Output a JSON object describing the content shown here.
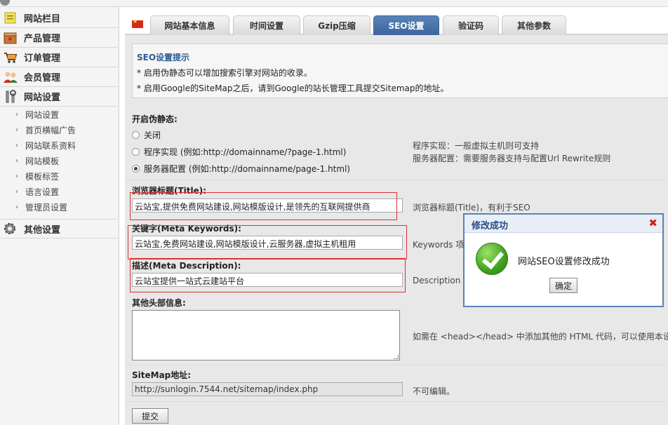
{
  "sidebar": {
    "sections": [
      {
        "label": "网站栏目",
        "icon": "note-icon"
      },
      {
        "label": "产品管理",
        "icon": "box-icon"
      },
      {
        "label": "订单管理",
        "icon": "cart-icon"
      },
      {
        "label": "会员管理",
        "icon": "users-icon"
      },
      {
        "label": "网站设置",
        "icon": "tools-icon"
      }
    ],
    "sub_items": [
      "网站设置",
      "首页横幅广告",
      "网站联系资料",
      "网站模板",
      "模板标签",
      "语言设置",
      "管理员设置"
    ],
    "bottom_section": {
      "label": "其他设置",
      "icon": "gear-icon"
    }
  },
  "tabs": [
    {
      "label": "网站基本信息",
      "active": false
    },
    {
      "label": "时间设置",
      "active": false
    },
    {
      "label": "Gzip压缩",
      "active": false
    },
    {
      "label": "SEO设置",
      "active": true
    },
    {
      "label": "验证码",
      "active": false
    },
    {
      "label": "其他参数",
      "active": false
    }
  ],
  "tip": {
    "title": "SEO设置提示",
    "lines": [
      "* 启用伪静态可以增加搜索引擎对网站的收录。",
      "* 启用Google的SiteMap之后，请到Google的站长管理工具提交Sitemap的地址。"
    ]
  },
  "rewrite": {
    "label": "开启伪静态:",
    "options": [
      {
        "label": "关闭",
        "selected": false
      },
      {
        "label": "程序实现 (例如:http://domainname/?page-1.html)",
        "selected": false
      },
      {
        "label": "服务器配置 (例如:http://domainname/page-1.html)",
        "selected": true
      }
    ],
    "notes": [
      "程序实现：一般虚拟主机则可支持",
      "服务器配置：需要服务器支持与配置Url Rewrite规则"
    ]
  },
  "title_field": {
    "label": "浏览器标题(Title):",
    "value": "云站宝,提供免费网站建设,网站模版设计,是领先的互联网提供商",
    "note": "浏览器标题(Title)，有利于SEO"
  },
  "keywords_field": {
    "label": "关键字(Meta Keywords):",
    "value": "云站宝,免费网站建设,网站模版设计,云服务器,虚拟主机租用",
    "note": "Keywords 项"
  },
  "description_field": {
    "label": "描述(Meta Description):",
    "value": "云站宝提供一站式云建站平台",
    "note": "Description"
  },
  "head_field": {
    "label": "其他头部信息:",
    "note": "如需在 <head></head> 中添加其他的 HTML 代码，可以使用本设"
  },
  "sitemap_field": {
    "label": "SiteMap地址:",
    "value": "http://sunlogin.7544.net/sitemap/index.php",
    "note": "不可编辑。"
  },
  "submit_label": "提交",
  "dialog": {
    "title": "修改成功",
    "message": "网站SEO设置修改成功",
    "ok_label": "确定",
    "close_glyph": "✖"
  },
  "colors": {
    "accent": "#3c659d",
    "highlight": "#e03030",
    "success": "#3ea21c"
  }
}
